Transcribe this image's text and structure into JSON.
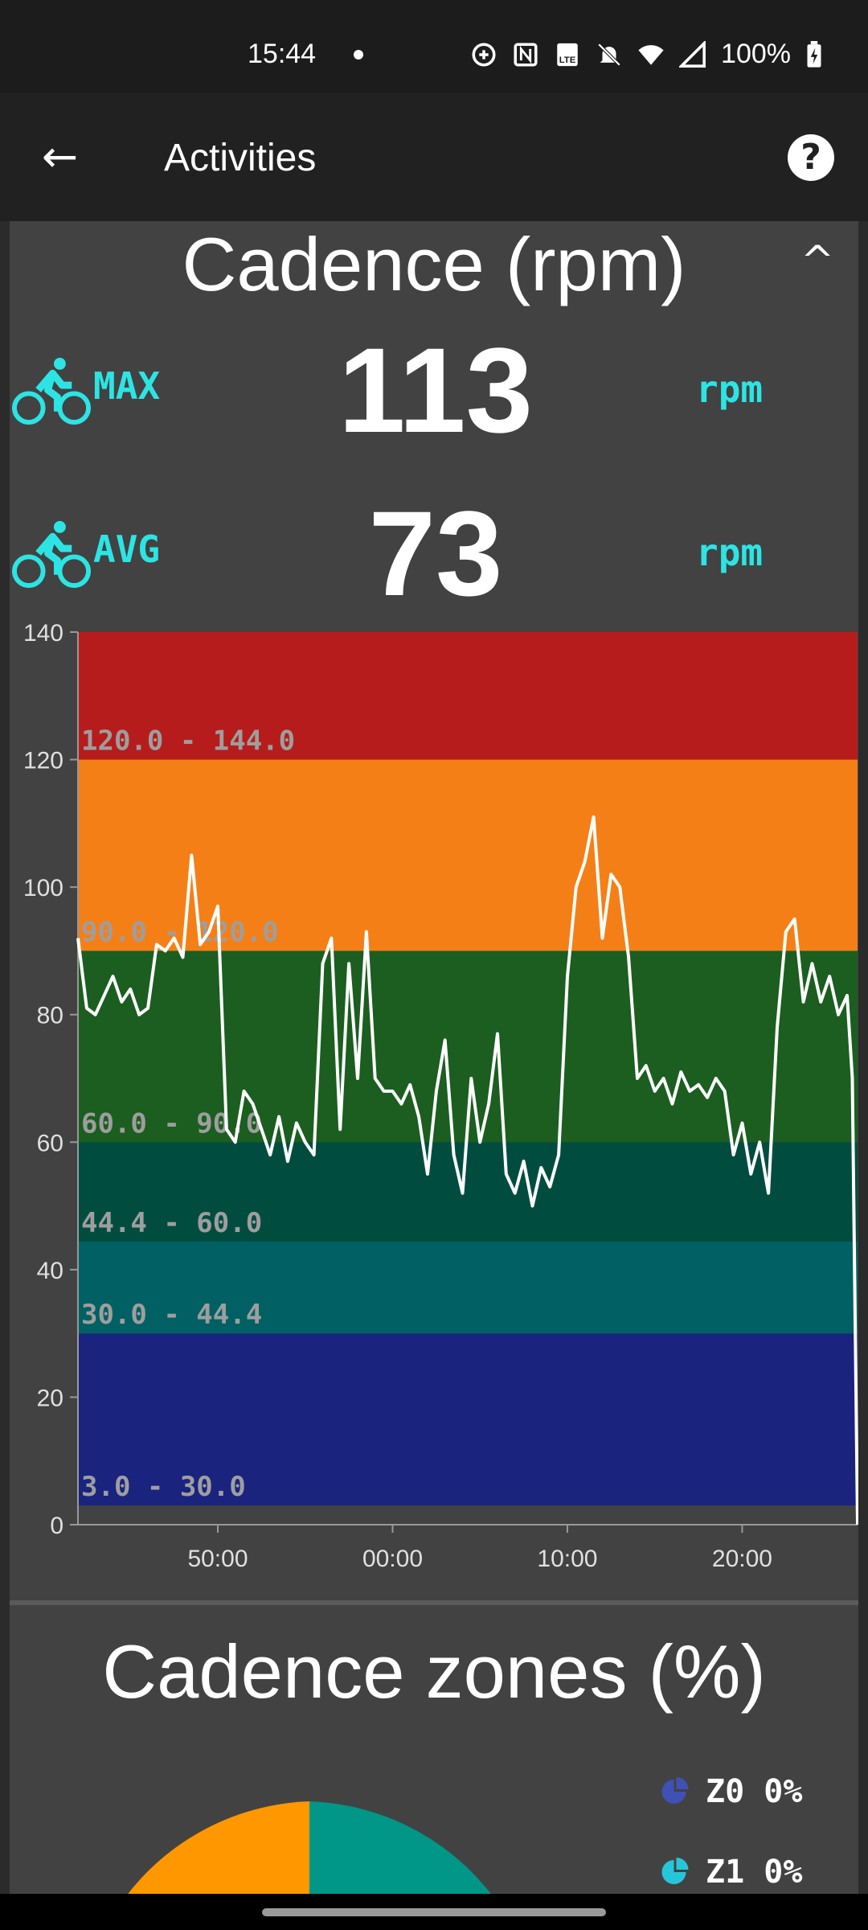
{
  "status_bar": {
    "time": "15:44",
    "battery": "100%",
    "icons": [
      "data-saver-icon",
      "nfc-icon",
      "volte-icon",
      "bell-off-icon",
      "wifi-icon",
      "signal-icon",
      "battery-charging-icon"
    ]
  },
  "app_bar": {
    "title": "Activities",
    "back_icon": "arrow-left-icon",
    "help_icon": "help-circle-icon"
  },
  "section": {
    "title": "Cadence (rpm)",
    "collapse_icon": "chevron-up-icon"
  },
  "stats": [
    {
      "label": "MAX",
      "value": "113",
      "unit": "rpm",
      "icon": "cyclist-icon"
    },
    {
      "label": "AVG",
      "value": "73",
      "unit": "rpm",
      "icon": "cyclist-icon"
    }
  ],
  "colors": {
    "accent": "#2de4e4",
    "card": "#424242"
  },
  "chart_data": {
    "type": "line",
    "ylim": [
      0,
      140
    ],
    "yticks": [
      "0",
      "20",
      "40",
      "60",
      "80",
      "100",
      "120",
      "140"
    ],
    "xticks": [
      "50:00",
      "00:00",
      "10:00",
      "20:00"
    ],
    "grid": false,
    "zones": [
      {
        "label": "3.0 - 30.0",
        "min": 3,
        "max": 30,
        "color": "#1a237e"
      },
      {
        "label": "30.0 - 44.4",
        "min": 30,
        "max": 44.4,
        "color": "#006064"
      },
      {
        "label": "44.4 - 60.0",
        "min": 44.4,
        "max": 60,
        "color": "#004d40"
      },
      {
        "label": "60.0 - 90.0",
        "min": 60,
        "max": 90,
        "color": "#1b5e20"
      },
      {
        "label": "90.0 - 120.0",
        "min": 90,
        "max": 120,
        "color": "#f57f17"
      },
      {
        "label": "120.0 - 144.0",
        "min": 120,
        "max": 144,
        "color": "#b71c1c"
      }
    ],
    "series": [
      {
        "color": "#ffffff",
        "points": [
          [
            "42:00",
            92
          ],
          [
            "42:30",
            81
          ],
          [
            "43:00",
            80
          ],
          [
            "43:30",
            83
          ],
          [
            "44:00",
            86
          ],
          [
            "44:30",
            82
          ],
          [
            "45:00",
            84
          ],
          [
            "45:30",
            80
          ],
          [
            "46:00",
            81
          ],
          [
            "46:30",
            91
          ],
          [
            "47:00",
            90
          ],
          [
            "47:30",
            92
          ],
          [
            "48:00",
            89
          ],
          [
            "48:30",
            105
          ],
          [
            "49:00",
            91
          ],
          [
            "49:30",
            93
          ],
          [
            "50:00",
            97
          ],
          [
            "50:30",
            62
          ],
          [
            "51:00",
            60
          ],
          [
            "51:30",
            68
          ],
          [
            "52:00",
            66
          ],
          [
            "52:30",
            62
          ],
          [
            "53:00",
            58
          ],
          [
            "53:30",
            64
          ],
          [
            "54:00",
            57
          ],
          [
            "54:30",
            63
          ],
          [
            "55:00",
            60
          ],
          [
            "55:30",
            58
          ],
          [
            "56:00",
            88
          ],
          [
            "56:30",
            92
          ],
          [
            "57:00",
            62
          ],
          [
            "57:30",
            88
          ],
          [
            "58:00",
            70
          ],
          [
            "58:30",
            93
          ],
          [
            "59:00",
            70
          ],
          [
            "59:30",
            68
          ],
          [
            "00:00",
            68
          ],
          [
            "00:30",
            66
          ],
          [
            "01:00",
            69
          ],
          [
            "01:30",
            64
          ],
          [
            "02:00",
            55
          ],
          [
            "02:30",
            68
          ],
          [
            "03:00",
            76
          ],
          [
            "03:30",
            58
          ],
          [
            "04:00",
            52
          ],
          [
            "04:30",
            70
          ],
          [
            "05:00",
            60
          ],
          [
            "05:30",
            66
          ],
          [
            "06:00",
            77
          ],
          [
            "06:30",
            55
          ],
          [
            "07:00",
            52
          ],
          [
            "07:30",
            57
          ],
          [
            "08:00",
            50
          ],
          [
            "08:30",
            56
          ],
          [
            "09:00",
            53
          ],
          [
            "09:30",
            58
          ],
          [
            "10:00",
            86
          ],
          [
            "10:30",
            100
          ],
          [
            "11:00",
            104
          ],
          [
            "11:30",
            111
          ],
          [
            "12:00",
            92
          ],
          [
            "12:30",
            102
          ],
          [
            "13:00",
            100
          ],
          [
            "13:30",
            89
          ],
          [
            "14:00",
            70
          ],
          [
            "14:30",
            72
          ],
          [
            "15:00",
            68
          ],
          [
            "15:30",
            70
          ],
          [
            "16:00",
            66
          ],
          [
            "16:30",
            71
          ],
          [
            "17:00",
            68
          ],
          [
            "17:30",
            69
          ],
          [
            "18:00",
            67
          ],
          [
            "18:30",
            70
          ],
          [
            "19:00",
            68
          ],
          [
            "19:30",
            58
          ],
          [
            "20:00",
            63
          ],
          [
            "20:30",
            55
          ],
          [
            "21:00",
            60
          ],
          [
            "21:30",
            52
          ],
          [
            "22:00",
            78
          ],
          [
            "22:30",
            93
          ],
          [
            "23:00",
            95
          ],
          [
            "23:30",
            82
          ],
          [
            "24:00",
            88
          ],
          [
            "24:30",
            82
          ],
          [
            "25:00",
            86
          ],
          [
            "25:30",
            80
          ],
          [
            "26:00",
            83
          ],
          [
            "26:18",
            70
          ],
          [
            "26:36",
            0
          ]
        ]
      }
    ]
  },
  "zones_section": {
    "title": "Cadence zones (%)",
    "legend": [
      {
        "label": "Z0 0%",
        "color": "#3f51b5"
      },
      {
        "label": "Z1 0%",
        "color": "#26c6da"
      }
    ],
    "pie_colors": [
      "#ff9800",
      "#009688"
    ]
  }
}
